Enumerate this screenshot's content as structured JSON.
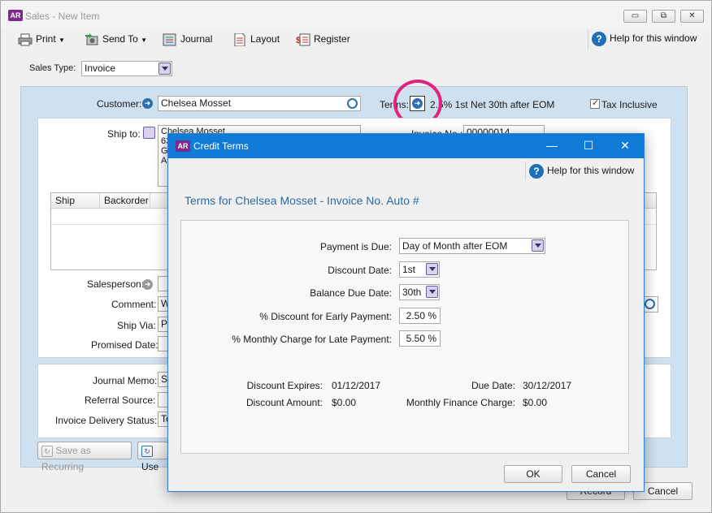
{
  "main_window": {
    "app_logo": "AR",
    "title": "Sales - New Item",
    "controls": {
      "minimize": "▭",
      "restore": "⧉",
      "close": "✕"
    }
  },
  "toolbar": {
    "print": "Print",
    "send_to": "Send To",
    "journal": "Journal",
    "layout": "Layout",
    "register": "Register",
    "help": "Help for this window"
  },
  "sales_type": {
    "label": "Sales Type:",
    "value": "Invoice"
  },
  "header": {
    "customer_label": "Customer:",
    "customer_value": "Chelsea Mosset",
    "terms_label": "Terms:",
    "terms_value": "2.5% 1st Net 30th after EOM",
    "tax_inclusive_label": "Tax Inclusive",
    "tax_inclusive_checked": true
  },
  "ship_to": {
    "label": "Ship to:",
    "line1": "Chelsea Mosset",
    "line2": "63",
    "line3": "Go",
    "line4": "Au"
  },
  "invoice_no": {
    "label": "Invoice No.:",
    "value": "00000014"
  },
  "grid": {
    "columns": [
      "Ship",
      "Backorder"
    ]
  },
  "details": {
    "salesperson_label": "Salesperson:",
    "comment_label": "Comment:",
    "comment_value": "W",
    "ship_via_label": "Ship Via:",
    "ship_via_value": "Pic",
    "promised_date_label": "Promised Date:"
  },
  "bottom": {
    "journal_memo_label": "Journal Memo:",
    "journal_memo_value": "Sa",
    "referral_source_label": "Referral Source:",
    "delivery_status_label": "Invoice Delivery Status:",
    "delivery_status_value": "To"
  },
  "bottom_buttons": {
    "save_recurring": "Save as Recurring",
    "use_recurring": "Use",
    "record": "Record",
    "cancel": "Cancel"
  },
  "dialog": {
    "app_logo": "AR",
    "title": "Credit Terms",
    "controls": {
      "minimize": "—",
      "maximize": "☐",
      "close": "✕"
    },
    "help": "Help for this window",
    "heading": "Terms for Chelsea Mosset - Invoice No. Auto #",
    "payment_due_label": "Payment is Due:",
    "payment_due_value": "Day of Month after EOM",
    "discount_date_label": "Discount Date:",
    "discount_date_value": "1st",
    "balance_due_date_label": "Balance Due Date:",
    "balance_due_date_value": "30th",
    "early_discount_label": "% Discount for Early Payment:",
    "early_discount_value": "2.50 %",
    "late_charge_label": "% Monthly Charge for Late Payment:",
    "late_charge_value": "5.50 %",
    "discount_expires_label": "Discount Expires:",
    "discount_expires_value": "01/12/2017",
    "due_date_label": "Due Date:",
    "due_date_value": "30/12/2017",
    "discount_amount_label": "Discount Amount:",
    "discount_amount_value": "$0.00",
    "finance_charge_label": "Monthly Finance Charge:",
    "finance_charge_value": "$0.00",
    "ok": "OK",
    "cancel": "Cancel"
  },
  "colors": {
    "dialog_titlebar": "#0f7bd6",
    "accent_purple": "#7b2a8c",
    "highlight_ring": "#e0237f",
    "panel_blue": "#cfe0ef"
  }
}
